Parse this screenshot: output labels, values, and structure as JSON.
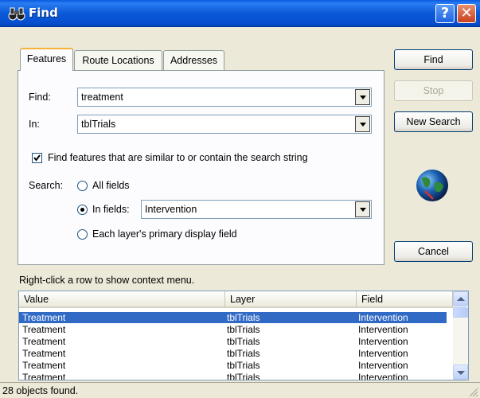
{
  "window": {
    "title": "Find",
    "help_glyph": "?",
    "close_glyph": "✕"
  },
  "tabs": [
    {
      "label": "Features",
      "active": true
    },
    {
      "label": "Route Locations",
      "active": false
    },
    {
      "label": "Addresses",
      "active": false
    }
  ],
  "form": {
    "find_label": "Find:",
    "find_value": "treatment",
    "in_label": "In:",
    "in_value": "tblTrials",
    "similar_checkbox_label": "Find features that are similar to or contain the search string",
    "similar_checked": true,
    "search_label": "Search:",
    "search_options": [
      {
        "label": "All fields",
        "selected": false
      },
      {
        "label": "In fields:",
        "selected": true
      },
      {
        "label": "Each layer's primary display field",
        "selected": false
      }
    ],
    "in_fields_value": "Intervention"
  },
  "buttons": {
    "find": "Find",
    "stop": "Stop",
    "new_search": "New Search",
    "cancel": "Cancel"
  },
  "hint": "Right-click a row to show context menu.",
  "results": {
    "columns": [
      "Value",
      "Layer",
      "Field"
    ],
    "rows": [
      [
        "Treatment",
        "tblTrials",
        "Intervention"
      ],
      [
        "Treatment",
        "tblTrials",
        "Intervention"
      ],
      [
        "Treatment",
        "tblTrials",
        "Intervention"
      ],
      [
        "Treatment",
        "tblTrials",
        "Intervention"
      ],
      [
        "Treatment",
        "tblTrials",
        "Intervention"
      ],
      [
        "Treatment",
        "tblTrials",
        "Intervention"
      ]
    ],
    "selected_row": 0
  },
  "status": "28 objects found.",
  "icons": {
    "title": "binoculars-icon",
    "globe": "globe-icon"
  },
  "colors": {
    "titlebar": "#0a5ad8",
    "selection": "#316ac5",
    "tab_accent": "#f7b23a"
  }
}
